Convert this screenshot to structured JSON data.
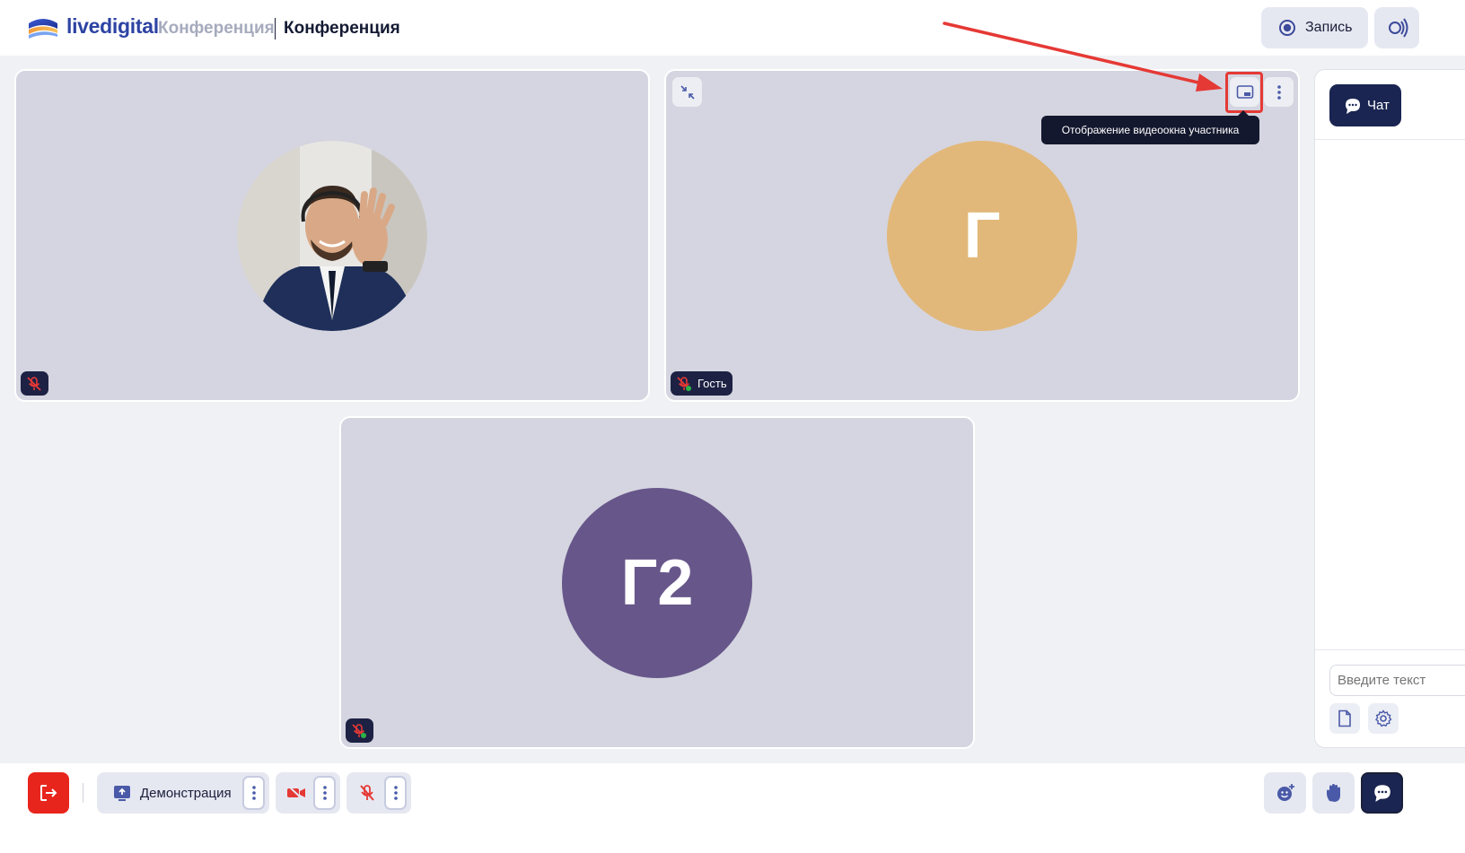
{
  "header": {
    "brand": "livedigital",
    "room_type": "Конференция",
    "room_name": "Конференция",
    "record_label": "Запись"
  },
  "tiles": [
    {
      "name": "participant-photo",
      "badge_label": ""
    },
    {
      "name": "participant-guest",
      "initials": "Г",
      "badge_label": "Гость",
      "avatar_color": "#e2b87a"
    },
    {
      "name": "participant-guest2",
      "initials": "Г2",
      "badge_label": "",
      "avatar_color": "#67568a"
    }
  ],
  "tooltip": {
    "text": "Отображение видеоокна участника"
  },
  "chat": {
    "tab_label": "Чат",
    "input_placeholder": "Введите текст"
  },
  "toolbar": {
    "demo_label": "Демонстрация"
  },
  "colors": {
    "accent": "#2d43a3",
    "danger": "#e8251d",
    "dark": "#1a2551",
    "tile_bg": "#d4d5e0"
  }
}
